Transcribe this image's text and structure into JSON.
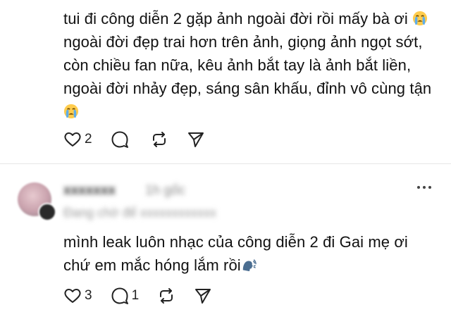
{
  "posts": [
    {
      "text_parts": [
        "tui đi công diễn 2 gặp ảnh ngoài đời rồi mấy bà ơi ",
        " ngoài đời đẹp trai hơn trên ảnh, giọng ảnh ngọt sớt, còn chiều fan nữa, kêu ảnh bắt tay là ảnh bắt liền, ngoài đời nhảy đẹp, sáng sân khấu, đỉnh vô cùng tận "
      ],
      "emoji": "loudly-crying-face",
      "like_count": "2",
      "reply_count": ""
    },
    {
      "author_blurred": "xxxxxxx",
      "time_blurred": "1h gốc",
      "subtitle_blurred": "Đang chờ để xxxxxxxxxxxx",
      "text_parts": [
        "mình leak luôn nhạc của công diễn 2 đi Gai mẹ ơi chứ em mắc hóng lắm rồi"
      ],
      "emoji": "speaking-head",
      "like_count": "3",
      "reply_count": "1"
    }
  ]
}
